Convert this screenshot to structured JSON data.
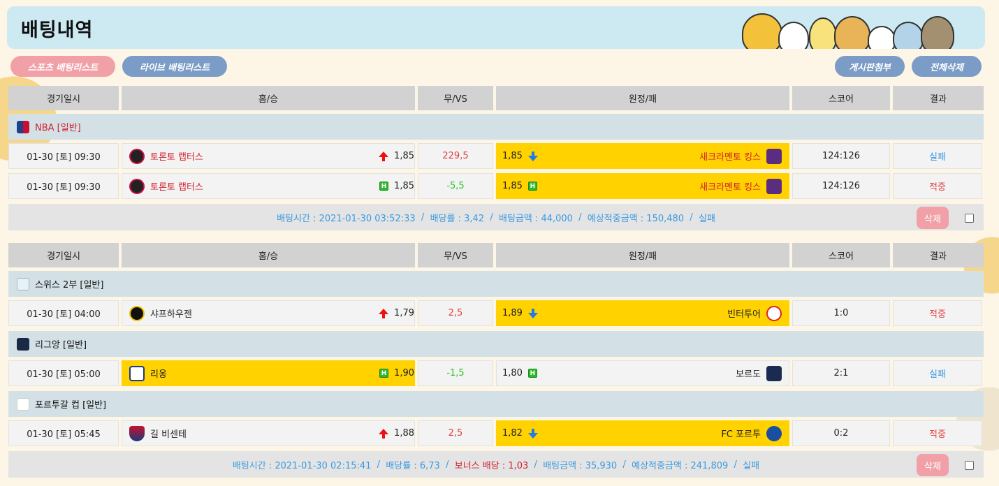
{
  "page_title": "배팅내역",
  "buttons": {
    "sports": "스포츠 배팅리스트",
    "live": "라이브 배팅리스트",
    "attach": "게시판첨부",
    "delete_all": "전체삭제",
    "delete": "삭제"
  },
  "table_headers": [
    "경기일시",
    "홈/승",
    "무/VS",
    "원정/패",
    "스코어",
    "결과"
  ],
  "colors": {
    "selected": "#ffd200",
    "fail": "#3b9ae1",
    "hit": "#e04040"
  },
  "bets": [
    {
      "groups": [
        {
          "league": "NBA [일반]",
          "league_icon": "nba-logo-icon",
          "games": [
            {
              "date": "01-30 [토] 09:30",
              "home": "토론토 랩터스",
              "home_odds": "1,85",
              "vs": "229,5",
              "away": "새크라멘토 킹스",
              "away_odds": "1,85",
              "score": "124:126",
              "result": "실패"
            },
            {
              "date": "01-30 [토] 09:30",
              "home": "토론토 랩터스",
              "home_odds": "1,85",
              "vs": "-5,5",
              "away": "새크라멘토 킹스",
              "away_odds": "1,85",
              "score": "124:126",
              "result": "적중"
            }
          ]
        }
      ],
      "summary": {
        "bet_time": "배팅시간 : 2021-01-30 03:52:33",
        "rate": "배당률 : 3,42",
        "amount": "배팅금액 : 44,000",
        "expected": "예상적중금액 : 150,480",
        "status": "실패"
      }
    },
    {
      "groups": [
        {
          "league": "스위스 2부 [일반]",
          "league_icon": "swiss-league-icon",
          "games": [
            {
              "date": "01-30 [토] 04:00",
              "home": "샤프하우젠",
              "home_odds": "1,79",
              "vs": "2,5",
              "away": "빈터투어",
              "away_odds": "1,89",
              "score": "1:0",
              "result": "적중"
            }
          ]
        },
        {
          "league": "리그앙 [일반]",
          "league_icon": "ligue1-icon",
          "games": [
            {
              "date": "01-30 [토] 05:00",
              "home": "리옹",
              "home_odds": "1,90",
              "vs": "-1,5",
              "away": "보르도",
              "away_odds": "1,80",
              "score": "2:1",
              "result": "실패"
            }
          ]
        },
        {
          "league": "포르투갈 컵 [일반]",
          "league_icon": "portugal-cup-icon",
          "games": [
            {
              "date": "01-30 [토] 05:45",
              "home": "길 비센테",
              "home_odds": "1,88",
              "vs": "2,5",
              "away": "FC 포르투",
              "away_odds": "1,82",
              "score": "0:2",
              "result": "적중"
            }
          ]
        }
      ],
      "summary": {
        "bet_time": "배팅시간 : 2021-01-30 02:15:41",
        "rate": "배당률 : 6,73",
        "bonus": "보너스 배당 : 1,03",
        "amount": "배팅금액 : 35,930",
        "expected": "예상적중금액 : 241,809",
        "status": "실패"
      }
    }
  ]
}
